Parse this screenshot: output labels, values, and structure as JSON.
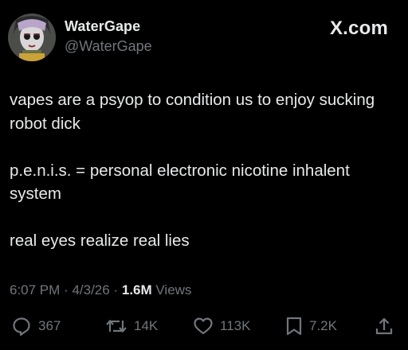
{
  "user": {
    "display_name": "WaterGape",
    "handle": "@WaterGape"
  },
  "brand": "X.com",
  "tweet": {
    "paragraphs": [
      "vapes are a psyop to condition us to enjoy sucking robot dick",
      "p.e.n.i.s. = personal electronic nicotine inhalent system",
      "real eyes realize real lies"
    ]
  },
  "meta": {
    "time": "6:07 PM",
    "separator": "·",
    "date": "4/3/26",
    "views_count": "1.6M",
    "views_label": "Views"
  },
  "actions": {
    "replies": "367",
    "reposts": "14K",
    "likes": "113K",
    "bookmarks": "7.2K",
    "icons": [
      "reply-icon",
      "repost-icon",
      "like-icon",
      "bookmark-icon",
      "share-icon"
    ]
  },
  "colors": {
    "background": "#000000",
    "text": "#e7e9ea",
    "muted": "#71767b"
  }
}
